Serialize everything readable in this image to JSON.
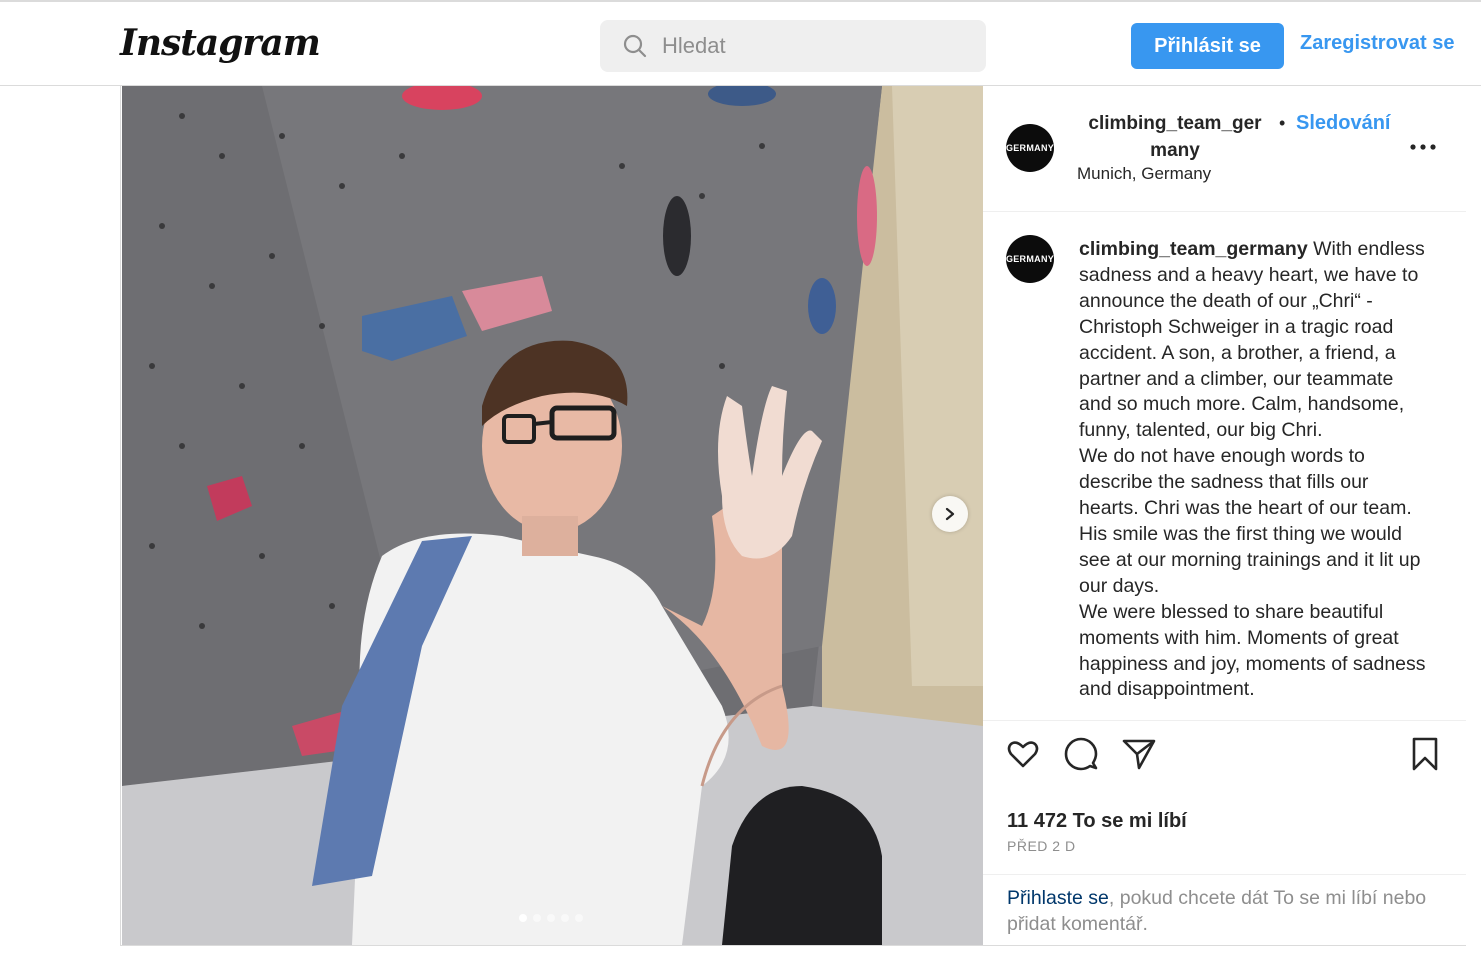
{
  "header": {
    "logo": "Instagram",
    "search_placeholder": "Hledat",
    "login_button": "Přihlásit se",
    "register_link": "Zaregistrovat se"
  },
  "post": {
    "username_line1": "climbing_team_ger",
    "username_line2": "many",
    "bullet": "•",
    "follow_label": "Sledování",
    "location": "Munich, Germany",
    "avatar_text": "GERMANY",
    "caption_username": "climbing_team_germany",
    "caption_text": " With endless sadness and a heavy heart, we have to announce the death of our „Chri“ - Christoph Schweiger in a tragic road accident. A son, a brother, a friend, a partner and a climber, our teammate and so much more. Calm, handsome, funny, talented, our big Chri.\nWe do not have enough words to describe the sadness that fills our hearts. Chri was the heart of our team. His smile was the first thing we would see at our morning trainings and it lit up our days.\nWe were blessed to share beautiful moments with him. Moments of great happiness and joy, moments of sadness and disappointment.",
    "likes": "11 472 To se mi líbí",
    "time": "PŘED 2 D",
    "login_prompt_link": "Přihlaste se",
    "login_prompt_rest": ", pokud chcete dát To se mi líbí nebo přidat komentář.",
    "carousel_count": 5,
    "carousel_active": 0
  },
  "colors": {
    "accent": "#3897f0",
    "border": "#dbdbdb",
    "muted": "#8e8e8e"
  }
}
